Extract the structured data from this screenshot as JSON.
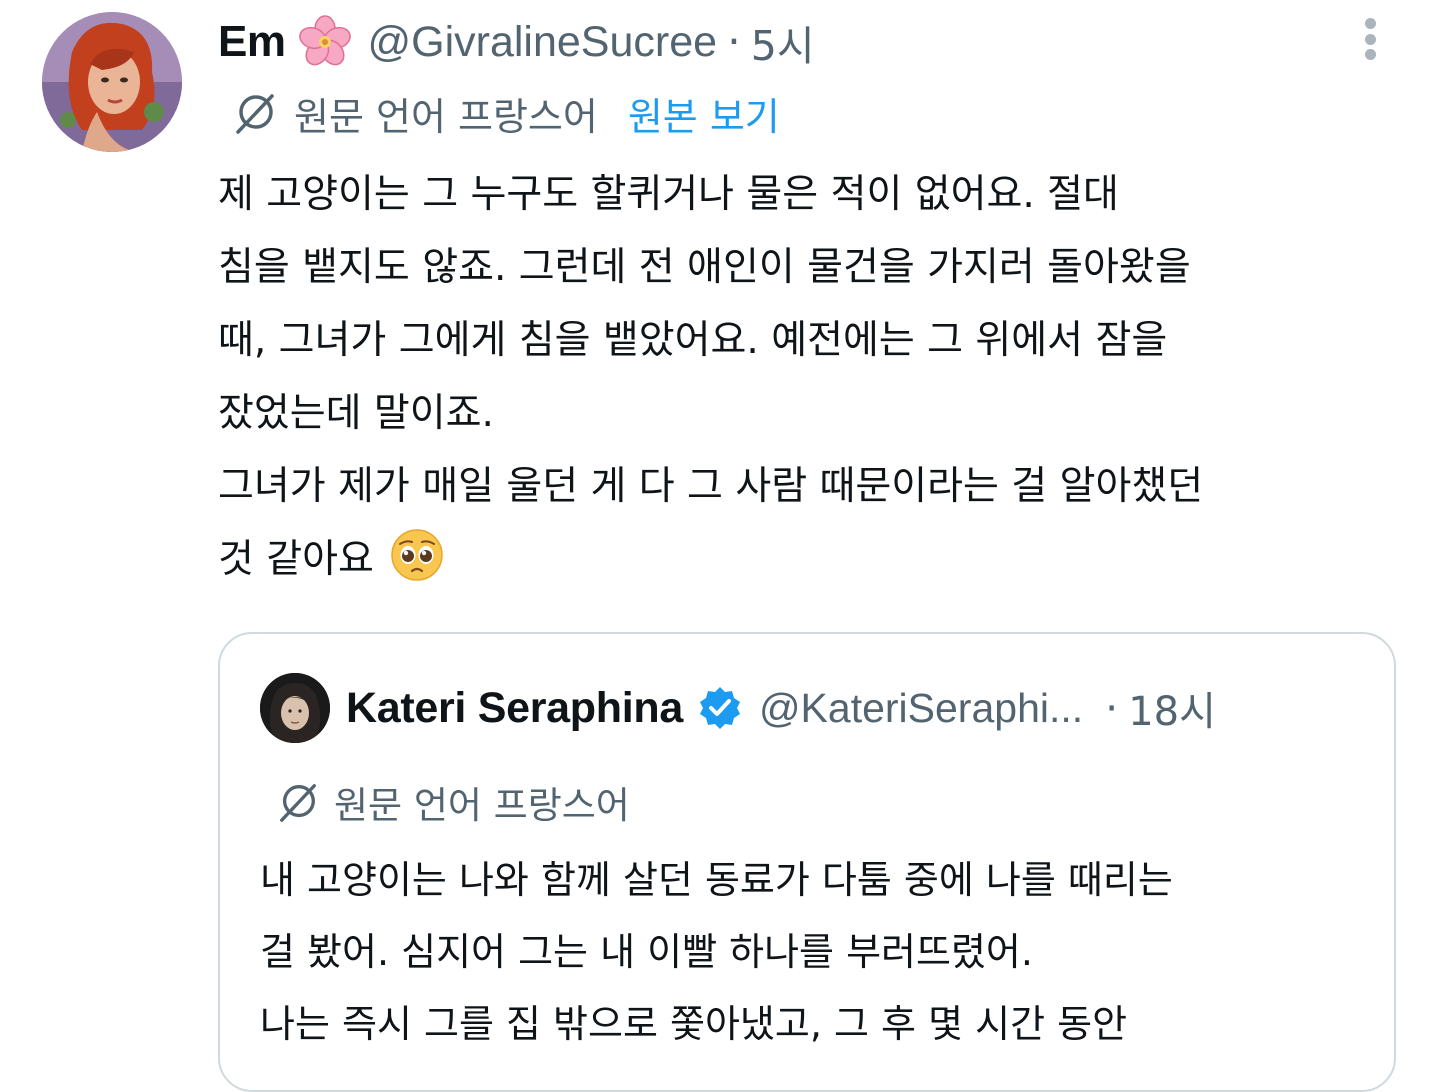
{
  "tweet": {
    "author": {
      "name": "Em",
      "name_emoji_icon": "cherry-blossom-icon",
      "handle": "@GivralineSucree",
      "separator": "·",
      "time": "5시"
    },
    "translation": {
      "icon": "globe-translate-icon",
      "label": "원문 언어 프랑스어",
      "show_original": "원본 보기"
    },
    "text_lines": [
      "제 고양이는 그 누구도 할퀴거나 물은 적이 없어요. 절대",
      "침을 뱉지도 않죠. 그런데 전 애인이 물건을 가지러 돌아왔을",
      "때, 그녀가 그에게 침을 뱉았어요. 예전에는 그 위에서 잠을",
      "잤었는데 말이죠.",
      "그녀가 제가 매일 울던 게 다 그 사람 때문이라는 걸 알아챘던",
      "것 같아요"
    ],
    "text_emoji_icon": "pleading-face-icon",
    "more_icon": "more-vertical-icon"
  },
  "quoted_tweet": {
    "author": {
      "name": "Kateri Seraphina",
      "verified_icon": "verified-badge-icon",
      "handle": "@KateriSeraphi...",
      "separator": "·",
      "time": "18시"
    },
    "translation": {
      "icon": "globe-translate-icon",
      "label": "원문 언어 프랑스어"
    },
    "text_lines": [
      "내 고양이는 나와 함께 살던 동료가 다툼 중에 나를 때리는",
      "걸 봤어. 심지어 그는 내 이빨 하나를 부러뜨렸어.",
      "나는 즉시 그를 집 밖으로 쫓아냈고, 그 후 몇 시간 동안"
    ]
  },
  "colors": {
    "text_primary": "#0f1419",
    "text_secondary": "#536471",
    "link_blue": "#1d9bf0",
    "border": "#cfd9de",
    "verified_blue": "#1d9bf0"
  }
}
